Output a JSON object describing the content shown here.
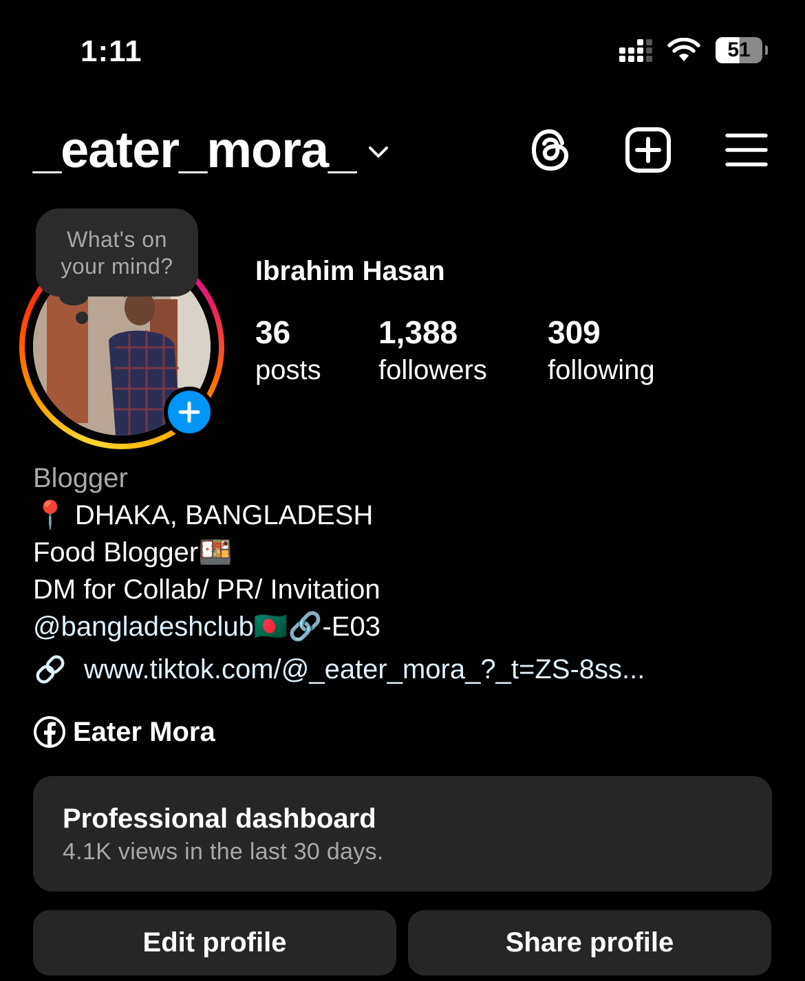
{
  "status_bar": {
    "time": "1:11",
    "battery": "51"
  },
  "header": {
    "username": "_eater_mora_"
  },
  "story_bubble": {
    "text_line1": "What's on",
    "text_line2": "your mind?"
  },
  "profile": {
    "display_name": "Ibrahim Hasan",
    "stats": [
      {
        "value": "36",
        "label": "posts"
      },
      {
        "value": "1,388",
        "label": "followers"
      },
      {
        "value": "309",
        "label": "following"
      }
    ]
  },
  "bio": {
    "category": "Blogger",
    "line1": "📍 DHAKA, BANGLADESH",
    "line2": "Food Blogger🍱",
    "line3": "DM for Collab/ PR/ Invitation",
    "mention": "@bangladeshclub",
    "line4_suffix": "🇧🇩🔗-E03",
    "link": "www.tiktok.com/@_eater_mora_?_t=ZS-8ss...",
    "facebook_name": "Eater Mora"
  },
  "dashboard": {
    "title": "Professional dashboard",
    "subtitle": "4.1K views in the last 30 days."
  },
  "buttons": {
    "edit": "Edit profile",
    "share": "Share profile"
  },
  "colors": {
    "background": "#000000",
    "card": "#262626",
    "accent_blue": "#0095f6",
    "link": "#e0f1ff"
  },
  "icons": [
    "threads-icon",
    "new-post-icon",
    "menu-icon",
    "chevron-down-icon",
    "link-icon",
    "facebook-icon",
    "plus-icon"
  ]
}
